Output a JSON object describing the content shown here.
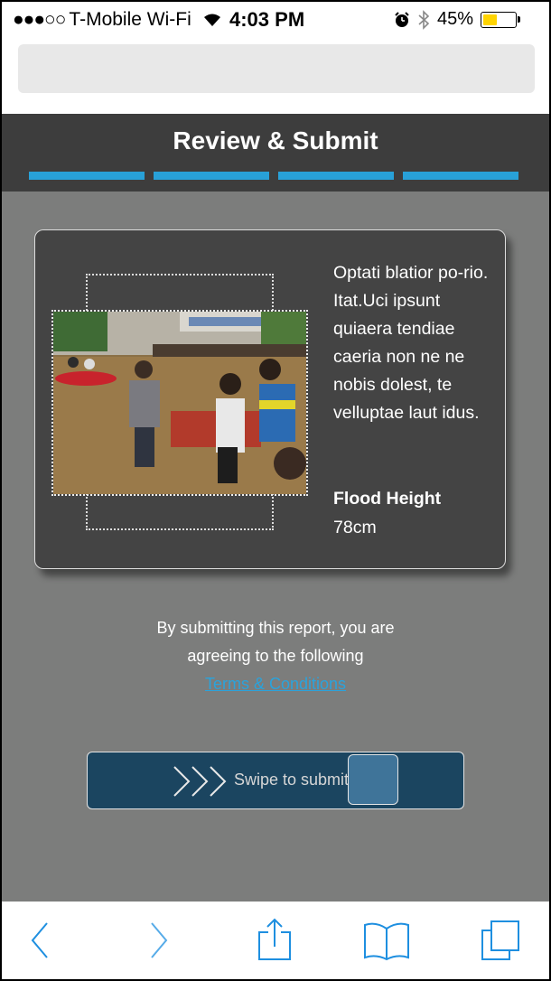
{
  "status_bar": {
    "signal": "●●●○○",
    "carrier": "T-Mobile Wi-Fi",
    "time": "4:03 PM",
    "battery_percent": "45%",
    "battery_level": 0.45
  },
  "header": {
    "title": "Review & Submit",
    "progress_steps": 4,
    "progress_completed": 4
  },
  "report": {
    "description": "Optati blatior po-rio. Itat.Uci ipsunt quiaera tendiae caeria non ne ne nobis dolest, te velluptae laut idus.",
    "flood_height_label": "Flood Height",
    "flood_height_value": "78cm"
  },
  "terms": {
    "line1": "By submitting this report, you are",
    "line2": "agreeing to the following",
    "link": "Terms & Conditions"
  },
  "swipe": {
    "label": "Swipe to submit"
  },
  "colors": {
    "header_bg": "#3d3d3d",
    "accent": "#28a1d8",
    "main_bg": "#7c7d7c",
    "card_bg": "#444444",
    "swipe_bg": "#1b4560",
    "toolbar_icon": "#1e8fe0"
  },
  "toolbar": {
    "icons": [
      "back-icon",
      "forward-icon",
      "share-icon",
      "bookmarks-icon",
      "tabs-icon"
    ]
  }
}
